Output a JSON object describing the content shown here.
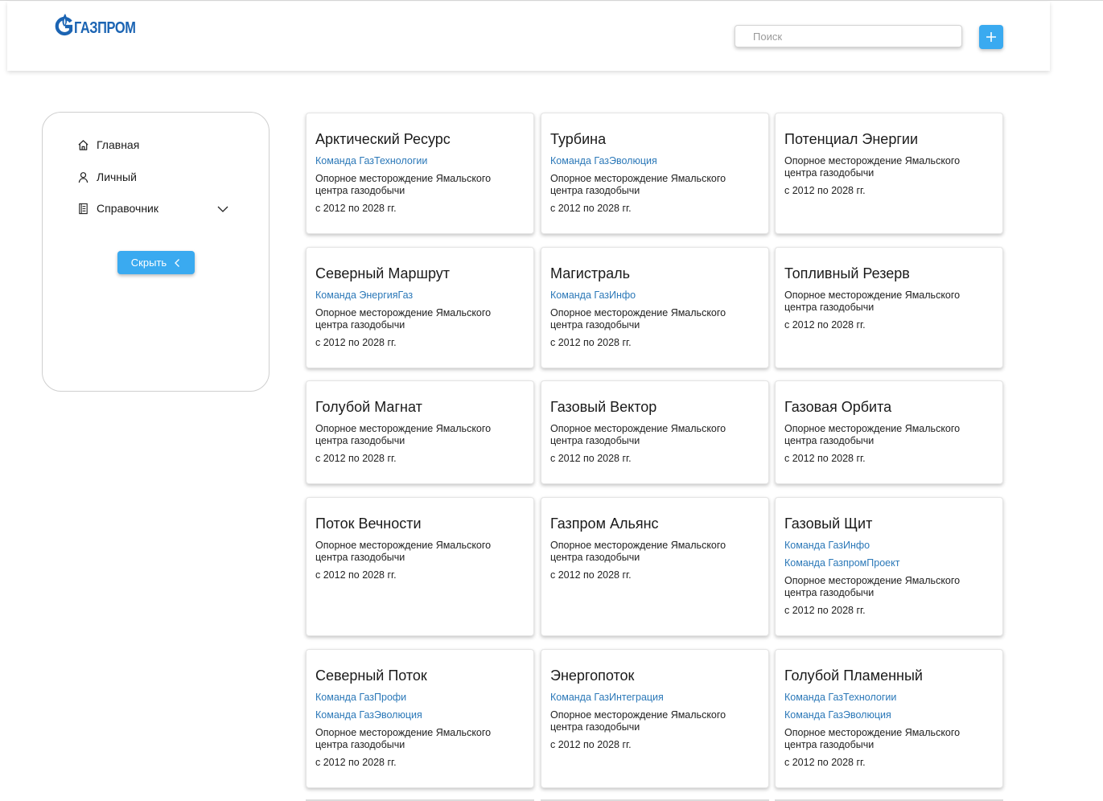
{
  "header": {
    "logo_text": "ГАЗПРОМ",
    "search_placeholder": "Поиск",
    "search_value": ""
  },
  "sidebar": {
    "items": [
      {
        "label": "Главная",
        "icon": "home-icon"
      },
      {
        "label": "Личный",
        "icon": "user-icon"
      },
      {
        "label": "Справочник",
        "icon": "book-icon"
      }
    ],
    "hide_label": "Скрыть"
  },
  "colors": {
    "accent": "#3aaaf0",
    "link": "#2b78b8",
    "brand": "#1b64b3"
  },
  "cards": [
    {
      "title": "Арктический Ресурс",
      "teams": [
        "Команда ГазТехнологии"
      ],
      "desc": "Опорное месторождение Ямальского центра газодобычи",
      "dates": "с 2012 по 2028 гг."
    },
    {
      "title": "Турбина",
      "teams": [
        "Команда ГазЭволюция"
      ],
      "desc": "Опорное месторождение Ямальского центра газодобычи",
      "dates": "с 2012 по 2028 гг."
    },
    {
      "title": "Потенциал Энергии",
      "teams": [],
      "desc": "Опорное месторождение Ямальского центра газодобычи",
      "dates": "с 2012 по 2028 гг."
    },
    {
      "title": "Северный Маршрут",
      "teams": [
        "Команда ЭнергияГаз"
      ],
      "desc": "Опорное месторождение Ямальского центра газодобычи",
      "dates": "с 2012 по 2028 гг."
    },
    {
      "title": "Магистраль",
      "teams": [
        "Команда ГазИнфо"
      ],
      "desc": "Опорное месторождение Ямальского центра газодобычи",
      "dates": "с 2012 по 2028 гг."
    },
    {
      "title": "Топливный Резерв",
      "teams": [],
      "desc": "Опорное месторождение Ямальского центра газодобычи",
      "dates": "с 2012 по 2028 гг."
    },
    {
      "title": "Голубой Магнат",
      "teams": [],
      "desc": "Опорное месторождение Ямальского центра газодобычи",
      "dates": "с 2012 по 2028 гг."
    },
    {
      "title": "Газовый Вектор",
      "teams": [],
      "desc": "Опорное месторождение Ямальского центра газодобычи",
      "dates": "с 2012 по 2028 гг."
    },
    {
      "title": "Газовая Орбита",
      "teams": [],
      "desc": "Опорное месторождение Ямальского центра газодобычи",
      "dates": "с 2012 по 2028 гг."
    },
    {
      "title": "Поток Вечности",
      "teams": [],
      "desc": "Опорное месторождение Ямальского центра газодобычи",
      "dates": "с 2012 по 2028 гг."
    },
    {
      "title": "Газпром Альянс",
      "teams": [],
      "desc": "Опорное месторождение Ямальского центра газодобычи",
      "dates": "с 2012 по 2028 гг."
    },
    {
      "title": "Газовый Щит",
      "teams": [
        "Команда ГазИнфо",
        "Команда ГазпромПроект"
      ],
      "desc": "Опорное месторождение Ямальского центра газодобычи",
      "dates": "с 2012 по 2028 гг."
    },
    {
      "title": "Северный Поток",
      "teams": [
        "Команда ГазПрофи",
        "Команда ГазЭволюция"
      ],
      "desc": "Опорное месторождение Ямальского центра газодобычи",
      "dates": "с 2012 по 2028 гг."
    },
    {
      "title": "Энергопоток",
      "teams": [
        "Команда ГазИнтеграция"
      ],
      "desc": "Опорное месторождение Ямальского центра газодобычи",
      "dates": "с 2012 по 2028 гг."
    },
    {
      "title": "Голубой Пламенный",
      "teams": [
        "Команда ГазТехнологии",
        "Команда ГазЭволюция"
      ],
      "desc": "Опорное месторождение Ямальского центра газодобычи",
      "dates": "с 2012 по 2028 гг."
    }
  ]
}
